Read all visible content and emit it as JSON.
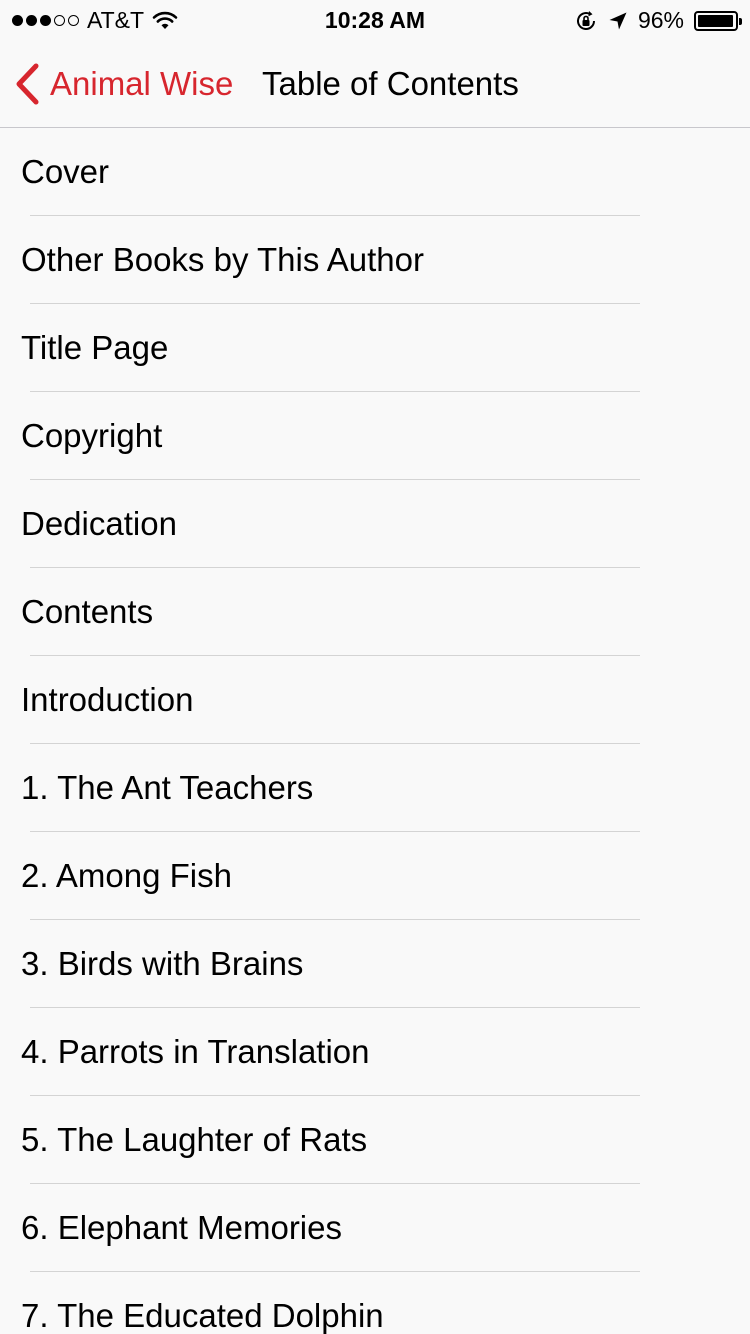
{
  "status_bar": {
    "carrier": "AT&T",
    "time": "10:28 AM",
    "battery_percent": "96%",
    "battery_level": 0.96,
    "signal_bars_filled": 3,
    "signal_bars_total": 5
  },
  "nav": {
    "back_label": "Animal Wise",
    "title": "Table of Contents",
    "accent_color": "#d7262e"
  },
  "toc": [
    "Cover",
    "Other Books by This Author",
    "Title Page",
    "Copyright",
    "Dedication",
    "Contents",
    "Introduction",
    "1. The Ant Teachers",
    "2. Among Fish",
    "3. Birds with Brains",
    "4. Parrots in Translation",
    "5. The Laughter of Rats",
    "6. Elephant Memories",
    "7. The Educated Dolphin"
  ]
}
